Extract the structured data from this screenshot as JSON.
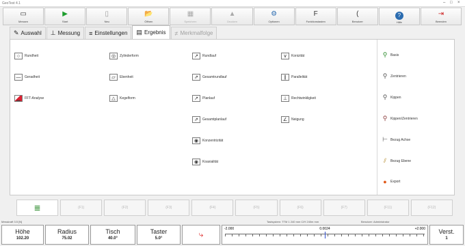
{
  "window": {
    "title": "GeoTest 4.1"
  },
  "toolbar": [
    {
      "label": "Messen",
      "icon": "measure-icon",
      "glyph": "▭",
      "color": "#333",
      "disabled": false
    },
    {
      "label": "Start",
      "icon": "play-icon",
      "glyph": "▶",
      "color": "#1e9e2e",
      "disabled": false
    },
    {
      "label": "Neu",
      "icon": "new-doc-icon",
      "glyph": "▯",
      "color": "#999",
      "disabled": false
    },
    {
      "label": "Öffnen",
      "icon": "open-folder-icon",
      "glyph": "📂",
      "color": "#c90",
      "disabled": false
    },
    {
      "label": "Speichern",
      "icon": "save-icon",
      "glyph": "▦",
      "color": "#aaa",
      "disabled": true
    },
    {
      "label": "Drucken",
      "icon": "print-icon",
      "glyph": "▲",
      "color": "#aaa",
      "disabled": true
    },
    {
      "label": "Optionen",
      "icon": "gear-icon",
      "glyph": "⚙",
      "color": "#2b6cb0",
      "disabled": false
    },
    {
      "label": "Funktionstasten",
      "icon": "function-keys-icon",
      "glyph": "F",
      "color": "#333",
      "disabled": false
    },
    {
      "label": "Benutzer",
      "icon": "user-icon",
      "glyph": "(",
      "color": "#333",
      "disabled": false
    },
    {
      "label": "Hilfe",
      "icon": "help-icon",
      "glyph": "?",
      "color": "#fff",
      "disabled": false
    },
    {
      "label": "Beenden",
      "icon": "exit-icon",
      "glyph": "⇥",
      "color": "#c22",
      "disabled": false
    }
  ],
  "tabs": [
    {
      "label": "Auswahl",
      "icon": "select-icon",
      "glyph": "✎",
      "active": false,
      "disabled": false
    },
    {
      "label": "Messung",
      "icon": "measure-tab-icon",
      "glyph": "⊥",
      "active": false,
      "disabled": false
    },
    {
      "label": "Einstellungen",
      "icon": "settings-icon",
      "glyph": "≡",
      "active": false,
      "disabled": false
    },
    {
      "label": "Ergebnis",
      "icon": "result-icon",
      "glyph": "▤",
      "active": true,
      "disabled": false
    },
    {
      "label": "Merkmalfolge",
      "icon": "sequence-icon",
      "glyph": "≠",
      "active": false,
      "disabled": true
    }
  ],
  "features": {
    "col1": [
      {
        "label": "Rundheit",
        "icon": "roundness-icon",
        "glyph": "○"
      },
      {
        "label": "Geradheit",
        "icon": "straightness-icon",
        "glyph": "—"
      },
      {
        "label": "FFT-Analyse",
        "icon": "fft-icon",
        "glyph": "▁"
      }
    ],
    "col2": [
      {
        "label": "Zylinderform",
        "icon": "cylindricity-icon",
        "glyph": "◎"
      },
      {
        "label": "Ebenheit",
        "icon": "flatness-icon",
        "glyph": "▱"
      },
      {
        "label": "Kegelform",
        "icon": "cone-icon",
        "glyph": "△"
      }
    ],
    "col3": [
      {
        "label": "Rundlauf",
        "icon": "runout-icon",
        "glyph": "↗"
      },
      {
        "label": "Gesamtrundlauf",
        "icon": "total-runout-icon",
        "glyph": "⇗"
      },
      {
        "label": "Planlauf",
        "icon": "axial-runout-icon",
        "glyph": "↗"
      },
      {
        "label": "Gesamtplanlauf",
        "icon": "total-axial-runout-icon",
        "glyph": "⇗"
      },
      {
        "label": "Konzentrizität",
        "icon": "concentricity-icon",
        "glyph": "◉"
      },
      {
        "label": "Koaxialität",
        "icon": "coaxiality-icon",
        "glyph": "◉"
      }
    ],
    "col4": [
      {
        "label": "Konizität",
        "icon": "conicity-icon",
        "glyph": "∨"
      },
      {
        "label": "Parallelität",
        "icon": "parallelism-icon",
        "glyph": "∥"
      },
      {
        "label": "Rechtwinkligkeit",
        "icon": "perpendicularity-icon",
        "glyph": "⊥"
      },
      {
        "label": "Neigung",
        "icon": "angularity-icon",
        "glyph": "∠"
      }
    ],
    "right": [
      {
        "label": "Basis",
        "icon": "basis-icon",
        "glyph": "⚲",
        "color": "#2a8a2a"
      },
      {
        "label": "Zentrieren",
        "icon": "center-icon",
        "glyph": "⚲",
        "color": "#555"
      },
      {
        "label": "Kippen",
        "icon": "tilt-icon",
        "glyph": "⚲",
        "color": "#555"
      },
      {
        "label": "Kippen/Zentrieren",
        "icon": "tilt-center-icon",
        "glyph": "⚲",
        "color": "#8a3a3a"
      },
      {
        "label": "Bezug Achse",
        "icon": "ref-axis-icon",
        "glyph": "⊢",
        "color": "#555"
      },
      {
        "label": "Bezug Ebene",
        "icon": "ref-plane-icon",
        "glyph": "⫽",
        "color": "#b58a2a"
      },
      {
        "label": "Export",
        "icon": "export-icon",
        "glyph": "●",
        "color": "#e05a1a"
      }
    ]
  },
  "fkeys": [
    {
      "label": "",
      "icon": "grid-icon"
    },
    {
      "label": "(F1)"
    },
    {
      "label": "(F2)"
    },
    {
      "label": "(F3)"
    },
    {
      "label": "(F4)"
    },
    {
      "label": "(F5)"
    },
    {
      "label": "(F6)"
    },
    {
      "label": "(F7)"
    },
    {
      "label": "(F11)"
    },
    {
      "label": "(F12)"
    }
  ],
  "status": {
    "left": "Messkraft 3.5 [N]",
    "center": "Tastsystem: TTM 1  240 mm  C/H  240m mm",
    "right": "Benutzer: Administrator"
  },
  "readouts": [
    {
      "label": "Höhe",
      "value": "102.20"
    },
    {
      "label": "Radius",
      "value": "75.02"
    },
    {
      "label": "Tisch",
      "value": "40.0°"
    },
    {
      "label": "Taster",
      "value": "5.0°"
    }
  ],
  "scale": {
    "min": "-2.000",
    "current": "0.0024",
    "max": "+2.000",
    "current_value": 0.0024,
    "range_min": -2.0,
    "range_max": 2.0
  },
  "version": {
    "label": "Verst.",
    "value": "1"
  }
}
